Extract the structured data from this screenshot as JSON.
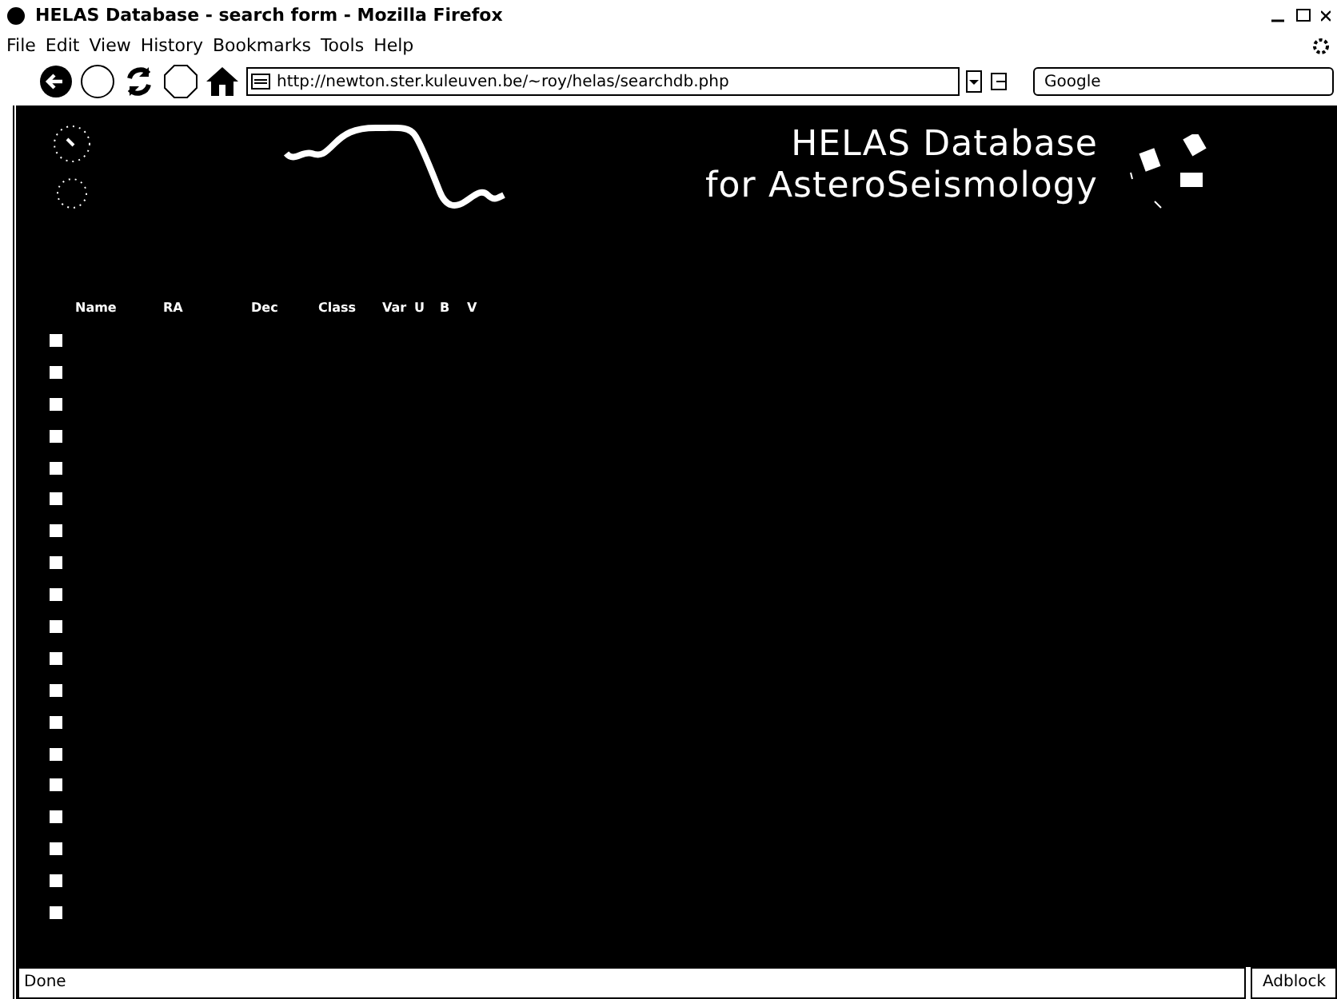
{
  "window": {
    "title": "HELAS Database - search form - Mozilla Firefox"
  },
  "menu": [
    "File",
    "Edit",
    "View",
    "History",
    "Bookmarks",
    "Tools",
    "Help"
  ],
  "address": {
    "value": "http://newton.ster.kuleuven.be/~roy/helas/searchdb.php"
  },
  "search": {
    "value": "Google"
  },
  "page": {
    "heading": [
      "HELAS Database",
      "for AsteroSeismology"
    ],
    "columns": [
      "Name",
      "RA",
      "Dec",
      "Class",
      "Var",
      "U",
      "B",
      "V"
    ],
    "rows": [
      {
        "checked": false
      },
      {
        "checked": false
      },
      {
        "checked": false
      },
      {
        "checked": false
      },
      {
        "checked": false
      },
      {
        "checked": false
      },
      {
        "checked": false
      },
      {
        "checked": false
      },
      {
        "checked": false
      },
      {
        "checked": false
      },
      {
        "checked": false
      },
      {
        "checked": false
      },
      {
        "checked": false
      },
      {
        "checked": false
      },
      {
        "checked": false
      },
      {
        "checked": false
      },
      {
        "checked": false
      },
      {
        "checked": false
      },
      {
        "checked": false
      }
    ]
  },
  "status_bar": {
    "text": "Done",
    "addon": "Adblock"
  }
}
